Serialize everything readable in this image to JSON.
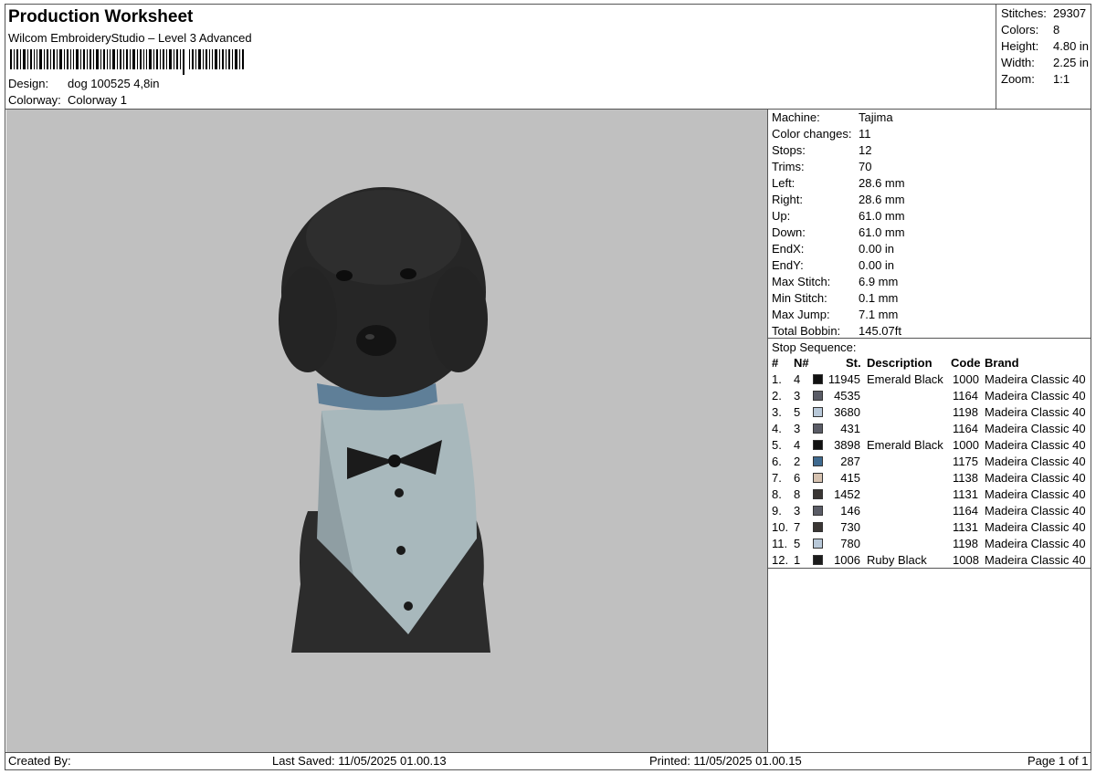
{
  "header": {
    "title": "Production Worksheet",
    "subtitle": "Wilcom EmbroideryStudio – Level 3 Advanced",
    "design_label": "Design:",
    "design_value": "dog 100525 4,8in",
    "colorway_label": "Colorway:",
    "colorway_value": "Colorway 1"
  },
  "summary": [
    {
      "label": "Stitches:",
      "value": "29307"
    },
    {
      "label": "Colors:",
      "value": "8"
    },
    {
      "label": "Height:",
      "value": "4.80 in"
    },
    {
      "label": "Width:",
      "value": "2.25 in"
    },
    {
      "label": "Zoom:",
      "value": "1:1"
    }
  ],
  "machine": [
    {
      "label": "Machine:",
      "value": "Tajima"
    },
    {
      "label": "Color changes:",
      "value": "11"
    },
    {
      "label": "Stops:",
      "value": "12"
    },
    {
      "label": "Trims:",
      "value": "70"
    },
    {
      "label": "Left:",
      "value": "28.6 mm"
    },
    {
      "label": "Right:",
      "value": "28.6 mm"
    },
    {
      "label": "Up:",
      "value": "61.0 mm"
    },
    {
      "label": "Down:",
      "value": "61.0 mm"
    },
    {
      "label": "EndX:",
      "value": "0.00 in"
    },
    {
      "label": "EndY:",
      "value": "0.00 in"
    },
    {
      "label": "Max Stitch:",
      "value": "6.9 mm"
    },
    {
      "label": "Min Stitch:",
      "value": "0.1 mm"
    },
    {
      "label": "Max Jump:",
      "value": "7.1 mm"
    },
    {
      "label": "Total Bobbin:",
      "value": "145.07ft"
    }
  ],
  "stop_sequence": {
    "title": "Stop Sequence:",
    "headers": {
      "num": "#",
      "n": "N#",
      "st": "St.",
      "description": "Description",
      "code": "Code",
      "brand": "Brand"
    },
    "rows": [
      {
        "num": "1.",
        "n": "4",
        "color": "#111111",
        "st": "11945",
        "description": "Emerald Black",
        "code": "1000",
        "brand": "Madeira Classic 40"
      },
      {
        "num": "2.",
        "n": "3",
        "color": "#5a5c66",
        "st": "4535",
        "description": "",
        "code": "1164",
        "brand": "Madeira Classic 40"
      },
      {
        "num": "3.",
        "n": "5",
        "color": "#b8c8d8",
        "st": "3680",
        "description": "",
        "code": "1198",
        "brand": "Madeira Classic 40"
      },
      {
        "num": "4.",
        "n": "3",
        "color": "#5a5c66",
        "st": "431",
        "description": "",
        "code": "1164",
        "brand": "Madeira Classic 40"
      },
      {
        "num": "5.",
        "n": "4",
        "color": "#111111",
        "st": "3898",
        "description": "Emerald Black",
        "code": "1000",
        "brand": "Madeira Classic 40"
      },
      {
        "num": "6.",
        "n": "2",
        "color": "#3f6a8f",
        "st": "287",
        "description": "",
        "code": "1175",
        "brand": "Madeira Classic 40"
      },
      {
        "num": "7.",
        "n": "6",
        "color": "#d6c2b0",
        "st": "415",
        "description": "",
        "code": "1138",
        "brand": "Madeira Classic 40"
      },
      {
        "num": "8.",
        "n": "8",
        "color": "#3a3634",
        "st": "1452",
        "description": "",
        "code": "1131",
        "brand": "Madeira Classic 40"
      },
      {
        "num": "9.",
        "n": "3",
        "color": "#5a5c66",
        "st": "146",
        "description": "",
        "code": "1164",
        "brand": "Madeira Classic 40"
      },
      {
        "num": "10.",
        "n": "7",
        "color": "#3a3634",
        "st": "730",
        "description": "",
        "code": "1131",
        "brand": "Madeira Classic 40"
      },
      {
        "num": "11.",
        "n": "5",
        "color": "#b8c8d8",
        "st": "780",
        "description": "",
        "code": "1198",
        "brand": "Madeira Classic 40"
      },
      {
        "num": "12.",
        "n": "1",
        "color": "#1c1c1c",
        "st": "1006",
        "description": "Ruby Black",
        "code": "1008",
        "brand": "Madeira Classic 40"
      }
    ]
  },
  "footer": {
    "created_by": "Created By:",
    "last_saved": "Last Saved: 11/05/2025 01.00.13",
    "printed": "Printed: 11/05/2025 01.00.15",
    "page": "Page 1 of 1"
  }
}
